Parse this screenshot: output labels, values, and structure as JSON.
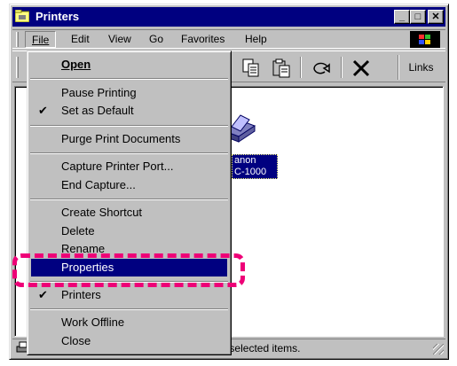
{
  "window": {
    "title": "Printers",
    "buttons": {
      "minimize": "_",
      "maximize": "□",
      "close": "✕"
    }
  },
  "menubar": {
    "items": [
      "File",
      "Edit",
      "View",
      "Go",
      "Favorites",
      "Help"
    ]
  },
  "toolbar": {
    "links_label": "Links"
  },
  "content": {
    "printer_label_line1": "anon",
    "printer_label_line2": "C-1000"
  },
  "statusbar": {
    "text": "Contains commands for working with the selected items."
  },
  "file_menu": {
    "items": [
      {
        "label": "Open",
        "bold": true
      },
      {
        "label": "Pause Printing"
      },
      {
        "label": "Set as Default",
        "checked": true
      },
      {
        "label": "Purge Print Documents"
      },
      {
        "label": "Capture Printer Port..."
      },
      {
        "label": "End Capture..."
      },
      {
        "label": "Create Shortcut"
      },
      {
        "label": "Delete"
      },
      {
        "label": "Rename"
      },
      {
        "label": "Properties",
        "highlighted": true
      },
      {
        "label": "Printers",
        "checked": true
      },
      {
        "label": "Work Offline"
      },
      {
        "label": "Close"
      }
    ],
    "check_glyph": "✔"
  },
  "colors": {
    "title_bar": "#000080",
    "annotation": "#ee0077",
    "face": "#c0c0c0"
  }
}
